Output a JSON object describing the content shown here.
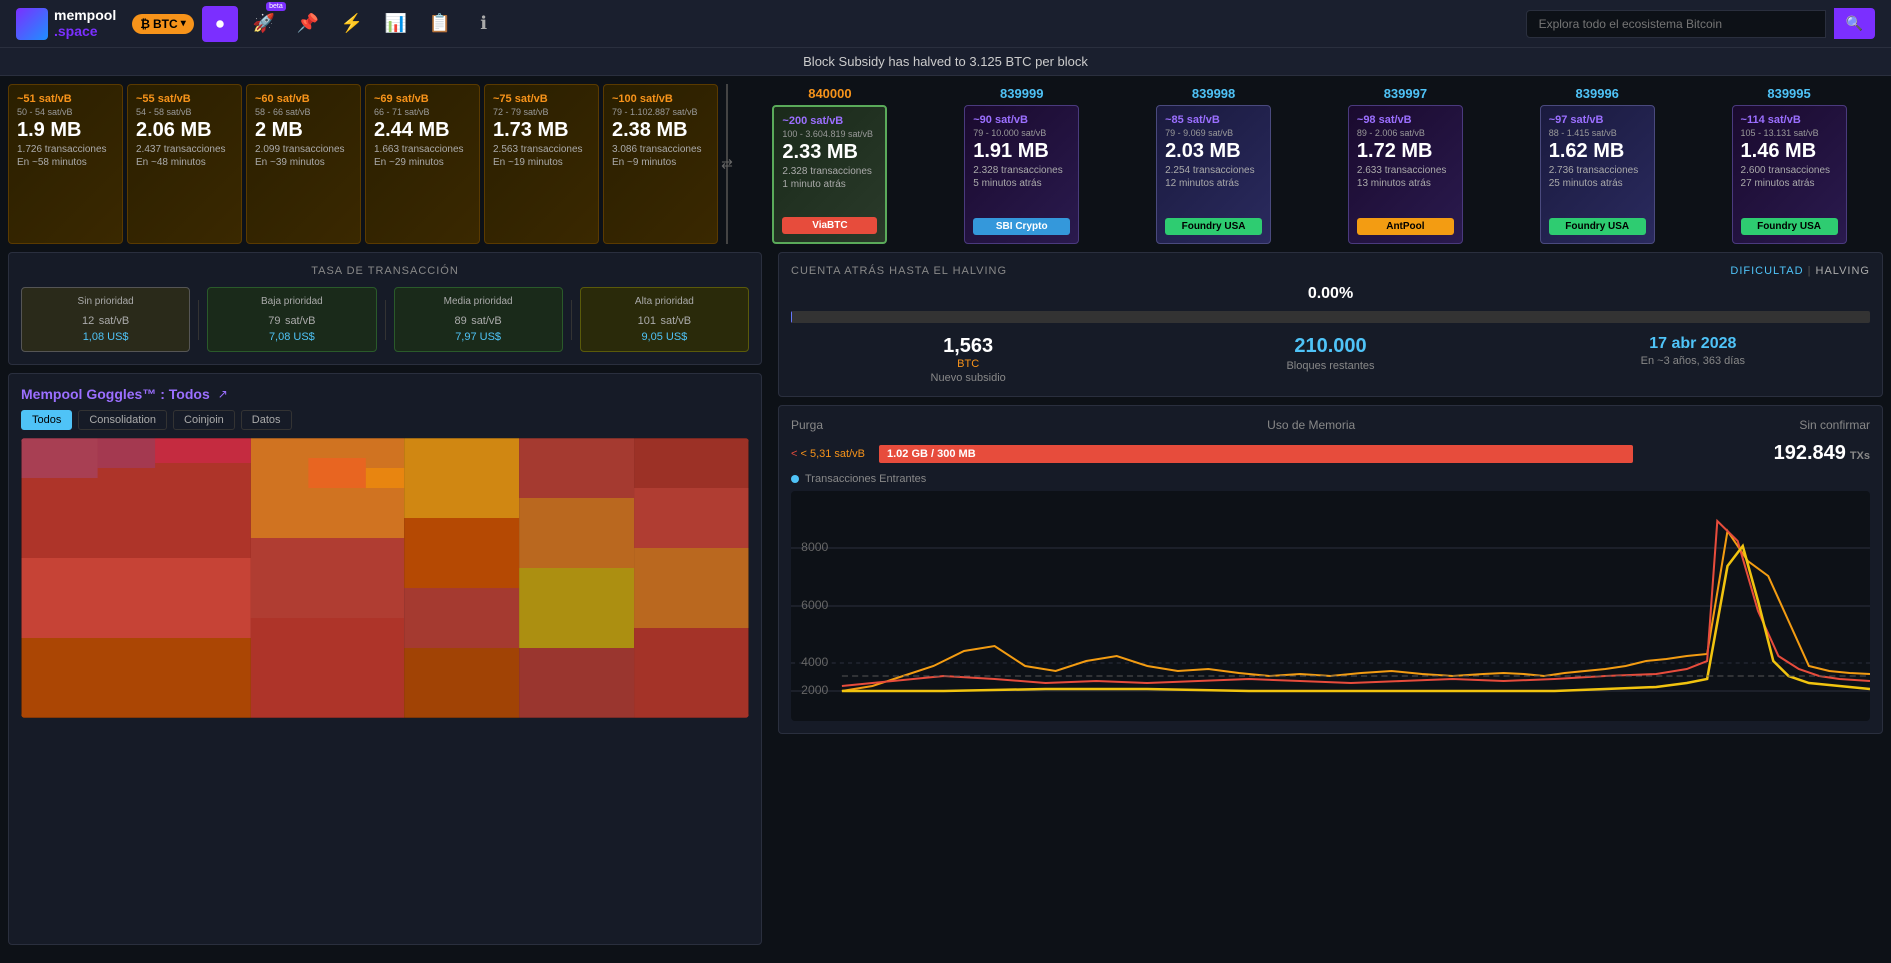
{
  "app": {
    "logo_top": "mempool",
    "logo_bottom": ".space",
    "search_placeholder": "Explora todo el ecosistema Bitcoin"
  },
  "nav": {
    "btc_label": "BTC",
    "beta_label": "beta"
  },
  "notice": {
    "text": "Block Subsidy has halved to 3.125 BTC per block"
  },
  "pending_blocks": [
    {
      "fee_rate": "~51 sat/vB",
      "fee_range": "50 - 54 sat/vB",
      "size": "1.9 MB",
      "txs": "1.726 transacciones",
      "eta": "En ~58 minutos"
    },
    {
      "fee_rate": "~55 sat/vB",
      "fee_range": "54 - 58 sat/vB",
      "size": "2.06 MB",
      "txs": "2.437 transacciones",
      "eta": "En ~48 minutos"
    },
    {
      "fee_rate": "~60 sat/vB",
      "fee_range": "58 - 66 sat/vB",
      "size": "2 MB",
      "txs": "2.099 transacciones",
      "eta": "En ~39 minutos"
    },
    {
      "fee_rate": "~69 sat/vB",
      "fee_range": "66 - 71 sat/vB",
      "size": "2.44 MB",
      "txs": "1.663 transacciones",
      "eta": "En ~29 minutos"
    },
    {
      "fee_rate": "~75 sat/vB",
      "fee_range": "72 - 79 sat/vB",
      "size": "1.73 MB",
      "txs": "2.563 transacciones",
      "eta": "En ~19 minutos"
    },
    {
      "fee_rate": "~100 sat/vB",
      "fee_range": "79 - 1.102.887 sat/vB",
      "size": "2.38 MB",
      "txs": "3.086 transacciones",
      "eta": "En ~9 minutos"
    }
  ],
  "confirmed_blocks": [
    {
      "number": "840000",
      "fee_rate": "~200 sat/vB",
      "fee_range": "100 - 3.604.819 sat/vB",
      "size": "2.33 MB",
      "txs": "2.328 transacciones",
      "time": "1 minuto atrás",
      "miner": "ViaBTC",
      "miner_class": "miner-viabtc",
      "number_class": "gold"
    },
    {
      "number": "839999",
      "fee_rate": "~90 sat/vB",
      "fee_range": "79 - 10.000 sat/vB",
      "size": "1.91 MB",
      "txs": "2.328 transacciones",
      "time": "5 minutos atrás",
      "miner": "SBI Crypto",
      "miner_class": "miner-sbi"
    },
    {
      "number": "839998",
      "fee_rate": "~85 sat/vB",
      "fee_range": "79 - 9.069 sat/vB",
      "size": "2.03 MB",
      "txs": "2.254 transacciones",
      "time": "12 minutos atrás",
      "miner": "Foundry USA",
      "miner_class": "miner-foundry"
    },
    {
      "number": "839997",
      "fee_rate": "~98 sat/vB",
      "fee_range": "89 - 2.006 sat/vB",
      "size": "1.72 MB",
      "txs": "2.633 transacciones",
      "time": "13 minutos atrás",
      "miner": "AntPool",
      "miner_class": "miner-antpool"
    },
    {
      "number": "839996",
      "fee_rate": "~97 sat/vB",
      "fee_range": "88 - 1.415 sat/vB",
      "size": "1.62 MB",
      "txs": "2.736 transacciones",
      "time": "25 minutos atrás",
      "miner": "Foundry USA",
      "miner_class": "miner-foundry2"
    },
    {
      "number": "839995",
      "fee_rate": "~114 sat/vB",
      "fee_range": "105 - 13.131 sat/vB",
      "size": "1.46 MB",
      "txs": "2.600 transacciones",
      "time": "27 minutos atrás",
      "miner": "Foundry USA",
      "miner_class": "miner-foundry3"
    }
  ],
  "fee_tiers": {
    "title": "TASA DE TRANSACCIÓN",
    "no_priority": {
      "label": "Sin prioridad",
      "sat": "12",
      "unit": "sat/vB",
      "usd": "1,08 US$"
    },
    "low": {
      "label": "Baja prioridad",
      "sat": "79",
      "unit": "sat/vB",
      "usd": "7,08 US$"
    },
    "med": {
      "label": "Media prioridad",
      "sat": "89",
      "unit": "sat/vB",
      "usd": "7,97 US$"
    },
    "high": {
      "label": "Alta prioridad",
      "sat": "101",
      "unit": "sat/vB",
      "usd": "9,05 US$"
    }
  },
  "goggles": {
    "title": "Mempool Goggles™ : Todos",
    "link_icon": "↗",
    "tabs": [
      "Todos",
      "Consolidation",
      "Coinjoin",
      "Datos"
    ]
  },
  "halving": {
    "title": "CUENTA ATRÁS HASTA EL HALVING",
    "difficulty_label": "dificultad",
    "halving_label": "halving",
    "percent": "0.00%",
    "progress": 0,
    "stats": [
      {
        "value": "1,563",
        "unit": "BTC",
        "label": "Nuevo subsidio"
      },
      {
        "value": "210.000",
        "unit": "",
        "label": "Bloques restantes"
      },
      {
        "value": "17 abr 2028",
        "unit": "",
        "label": "En ~3 años, 363 días"
      }
    ]
  },
  "mempool_status": {
    "purga_label": "Purga",
    "memoria_label": "Uso de Memoria",
    "sin_confirmar_label": "Sin confirmar",
    "purga_value": "< 5,31 sat/vB",
    "memoria_value": "1.02 GB / 300 MB",
    "sin_confirmar_value": "192.849",
    "sin_confirmar_unit": "TXs",
    "incoming_label": "Transacciones Entrantes",
    "chart_y_labels": [
      "8000",
      "6000",
      "4000",
      "2000"
    ]
  }
}
